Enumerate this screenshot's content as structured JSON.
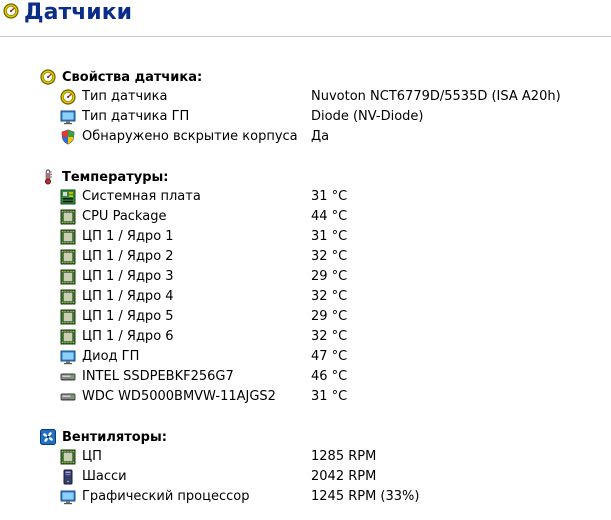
{
  "page": {
    "title": "Датчики"
  },
  "sections": [
    {
      "title": "Свойства датчика:",
      "icon": "sensor-gauge-icon",
      "rows": [
        {
          "name": "Тип датчика",
          "value": "Nuvoton NCT6779D/5535D  (ISA A20h)",
          "icon": "sensor-gauge-icon"
        },
        {
          "name": "Тип датчика ГП",
          "value": "Diode  (NV-Diode)",
          "icon": "monitor-icon"
        },
        {
          "name": "Обнаружено вскрытие корпуса",
          "value": "Да",
          "icon": "shield-icon"
        }
      ]
    },
    {
      "title": "Температуры:",
      "icon": "thermometer-icon",
      "rows": [
        {
          "name": "Системная плата",
          "value": "31 °C",
          "icon": "motherboard-icon"
        },
        {
          "name": "CPU Package",
          "value": "44 °C",
          "icon": "cpu-chip-icon"
        },
        {
          "name": "ЦП 1 / Ядро 1",
          "value": "31 °C",
          "icon": "cpu-chip-icon"
        },
        {
          "name": "ЦП 1 / Ядро 2",
          "value": "32 °C",
          "icon": "cpu-chip-icon"
        },
        {
          "name": "ЦП 1 / Ядро 3",
          "value": "29 °C",
          "icon": "cpu-chip-icon"
        },
        {
          "name": "ЦП 1 / Ядро 4",
          "value": "32 °C",
          "icon": "cpu-chip-icon"
        },
        {
          "name": "ЦП 1 / Ядро 5",
          "value": "29 °C",
          "icon": "cpu-chip-icon"
        },
        {
          "name": "ЦП 1 / Ядро 6",
          "value": "32 °C",
          "icon": "cpu-chip-icon"
        },
        {
          "name": "Диод ГП",
          "value": "47 °C",
          "icon": "monitor-icon"
        },
        {
          "name": "INTEL SSDPEBKF256G7",
          "value": "46 °C",
          "icon": "drive-icon"
        },
        {
          "name": "WDC WD5000BMVW-11AJGS2",
          "value": "31 °C",
          "icon": "drive-icon"
        }
      ]
    },
    {
      "title": "Вентиляторы:",
      "icon": "fan-icon",
      "rows": [
        {
          "name": "ЦП",
          "value": "1285 RPM",
          "icon": "cpu-chip-icon"
        },
        {
          "name": "Шасси",
          "value": "2042 RPM",
          "icon": "chassis-icon"
        },
        {
          "name": "Графический процессор",
          "value": "1245 RPM  (33%)",
          "icon": "monitor-icon"
        }
      ]
    }
  ],
  "colors": {
    "title": "#0b2d8a",
    "divider": "#c8c8c8"
  }
}
